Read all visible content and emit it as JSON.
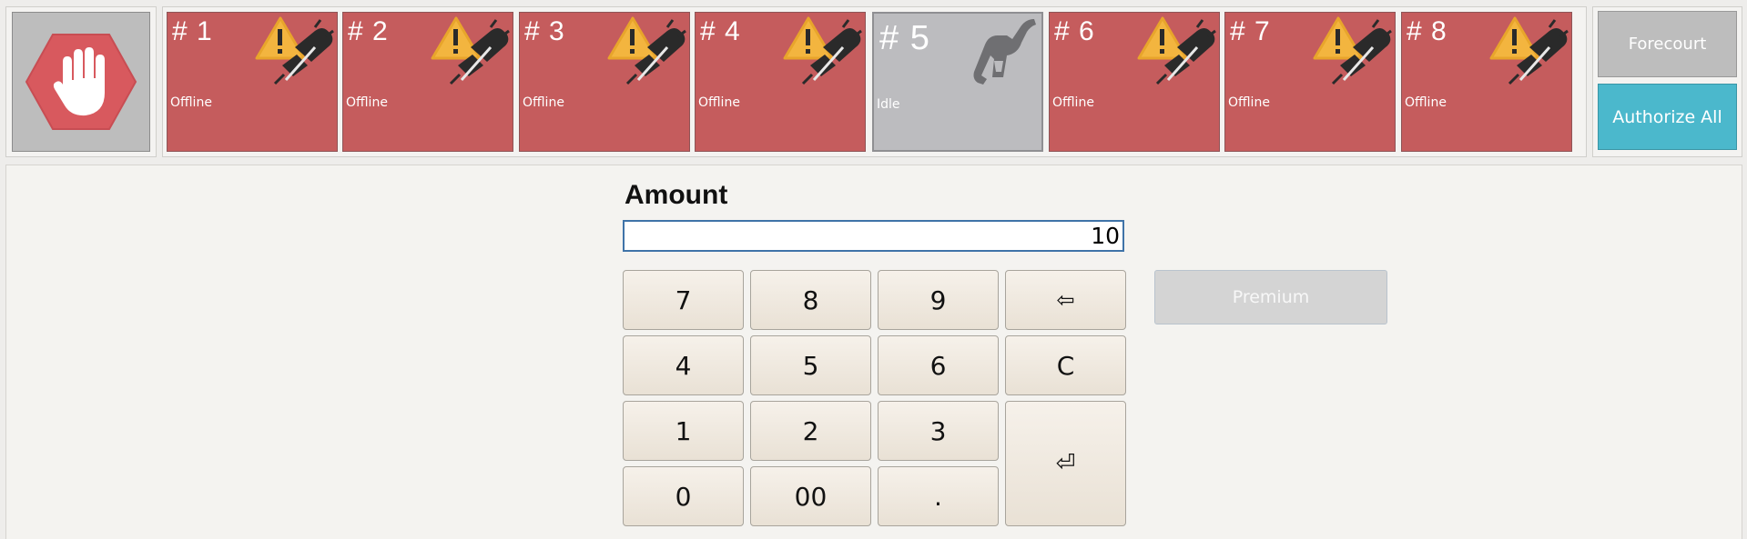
{
  "pumps": [
    {
      "label": "# 1",
      "status": "Offline",
      "state": "offline"
    },
    {
      "label": "# 2",
      "status": "Offline",
      "state": "offline"
    },
    {
      "label": "# 3",
      "status": "Offline",
      "state": "offline"
    },
    {
      "label": "# 4",
      "status": "Offline",
      "state": "offline"
    },
    {
      "label": "# 5",
      "status": "Idle",
      "state": "idle"
    },
    {
      "label": "# 6",
      "status": "Offline",
      "state": "offline"
    },
    {
      "label": "# 7",
      "status": "Offline",
      "state": "offline"
    },
    {
      "label": "# 8",
      "status": "Offline",
      "state": "offline"
    }
  ],
  "side_buttons": {
    "forecourt": "Forecourt",
    "authorize_all": "Authorize All"
  },
  "amount": {
    "label": "Amount",
    "value": "10"
  },
  "keypad": {
    "k7": "7",
    "k8": "8",
    "k9": "9",
    "backspace": "⇦",
    "k4": "4",
    "k5": "5",
    "k6": "6",
    "clear": "C",
    "k1": "1",
    "k2": "2",
    "k3": "3",
    "enter": "⏎",
    "k0": "0",
    "k00": "00",
    "dot": "."
  },
  "grade_button": "Premium",
  "icons": {
    "stop": "stop-hand-icon",
    "offline": "offline-warning-plug-icon",
    "idle": "fuel-nozzle-icon"
  },
  "colors": {
    "offline": "#c55c5d",
    "idle": "#bcbcbf",
    "authorize": "#4bb8cc",
    "stop": "#d8595e"
  }
}
